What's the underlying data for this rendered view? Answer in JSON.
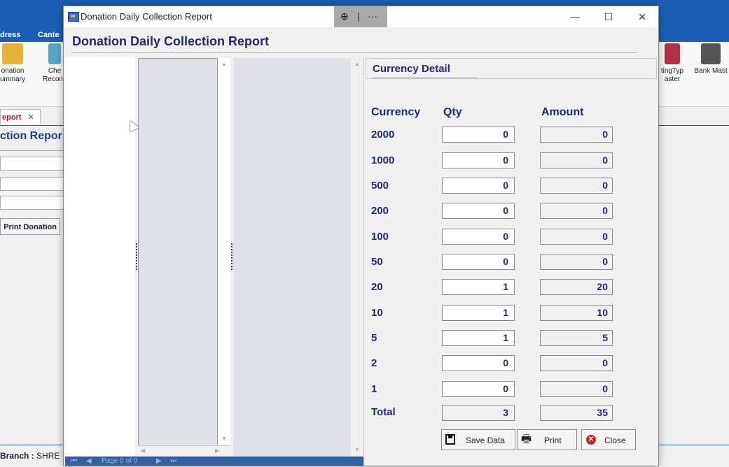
{
  "background": {
    "menu": [
      "dress",
      "Cante"
    ],
    "ribbon": [
      {
        "label": "onation\nummary",
        "icon": "donation-summary-icon"
      },
      {
        "label": "Che\nReconc",
        "icon": "cheque-reconcile-icon"
      },
      {
        "label": "tingTyp\naster",
        "icon": "meeting-type-master-icon"
      },
      {
        "label": "Bank Mast",
        "icon": "bank-icon"
      }
    ],
    "tab_label": "eport",
    "tab_close": "✕",
    "heading": "ction Repor",
    "print_button": "Print Donation",
    "status_branch_label": "Branch :",
    "status_branch_value": "SHRE"
  },
  "dialog": {
    "title": "Donation Daily Collection Report",
    "heading": "Donation Daily Collection Report",
    "zoom_icon": "zoom-in-icon",
    "more_label": "···",
    "nav": {
      "page_label": "Page 0 of 0"
    },
    "currency_panel": {
      "title": "Currency Detail",
      "headers": {
        "currency": "Currency",
        "qty": "Qty",
        "amount": "Amount"
      },
      "rows": [
        {
          "currency": "2000",
          "qty": "0",
          "amount": "0"
        },
        {
          "currency": "1000",
          "qty": "0",
          "amount": "0"
        },
        {
          "currency": "500",
          "qty": "0",
          "amount": "0"
        },
        {
          "currency": "200",
          "qty": "0",
          "amount": "0"
        },
        {
          "currency": "100",
          "qty": "0",
          "amount": "0"
        },
        {
          "currency": "50",
          "qty": "0",
          "amount": "0"
        },
        {
          "currency": "20",
          "qty": "1",
          "amount": "20"
        },
        {
          "currency": "10",
          "qty": "1",
          "amount": "10"
        },
        {
          "currency": "5",
          "qty": "1",
          "amount": "5"
        },
        {
          "currency": "2",
          "qty": "0",
          "amount": "0"
        },
        {
          "currency": "1",
          "qty": "0",
          "amount": "0"
        }
      ],
      "total": {
        "label": "Total",
        "qty": "3",
        "amount": "35"
      },
      "buttons": {
        "save": "Save Data",
        "print": "Print",
        "close": "Close"
      }
    }
  },
  "colors": {
    "accent": "#1a5fb4",
    "label_navy": "#1e2a6e",
    "close_red": "#c0282d"
  }
}
